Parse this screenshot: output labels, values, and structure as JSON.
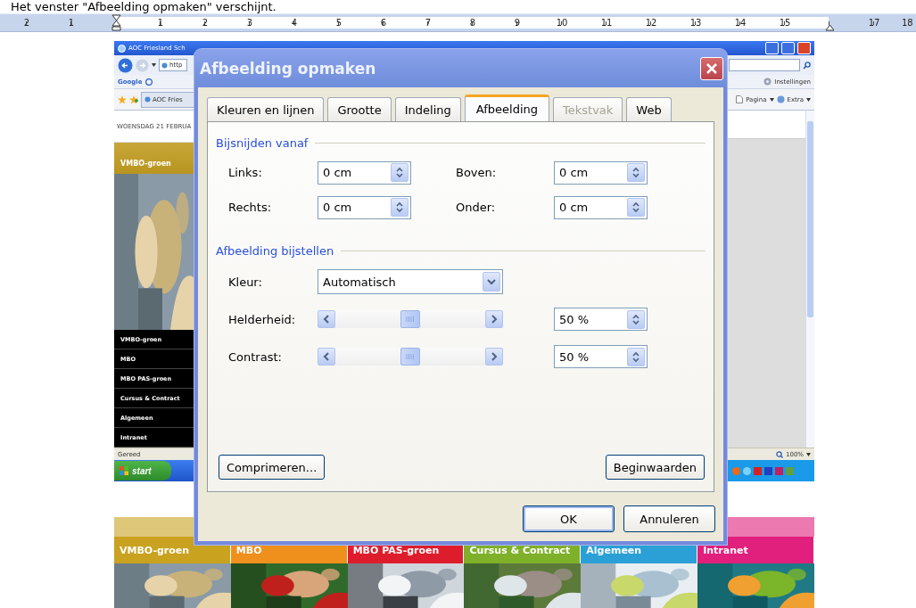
{
  "caption": "Het venster \"Afbeelding opmaken\" verschijnt.",
  "ruler": [
    {
      "kind": "number",
      "label": "2"
    },
    {
      "kind": "number",
      "label": "1"
    },
    {
      "kind": "indent"
    },
    {
      "kind": "number",
      "label": "1"
    },
    {
      "kind": "number",
      "label": "2"
    },
    {
      "kind": "number",
      "label": "3"
    },
    {
      "kind": "number",
      "label": "4"
    },
    {
      "kind": "number",
      "label": "5"
    },
    {
      "kind": "number",
      "label": "6"
    },
    {
      "kind": "number",
      "label": "7"
    },
    {
      "kind": "number",
      "label": "8"
    },
    {
      "kind": "number",
      "label": "9"
    },
    {
      "kind": "number",
      "label": "10"
    },
    {
      "kind": "number",
      "label": "11"
    },
    {
      "kind": "number",
      "label": "12"
    },
    {
      "kind": "number",
      "label": "13"
    },
    {
      "kind": "number",
      "label": "14"
    },
    {
      "kind": "number",
      "label": "15"
    },
    {
      "kind": "margin"
    },
    {
      "kind": "number",
      "label": "17"
    },
    {
      "kind": "number",
      "label": "18"
    }
  ],
  "browser": {
    "title": "AOC Friesland Sch",
    "address": "http",
    "search_brand": "Google",
    "settings": "Instellingen",
    "tab": "AOC Fries",
    "page_menu": "Pagina",
    "extra_menu": "Extra",
    "date": "WOENSDAG 21 FEBRUA",
    "section_title": "VMBO-groen",
    "menu": [
      "VMBO-groen",
      "MBO",
      "MBO PAS-groen",
      "Cursus & Contract",
      "Algemeen",
      "Intranet"
    ],
    "status": "Gereed",
    "zoom": "100%",
    "start": "start"
  },
  "dialog": {
    "title": "Afbeelding opmaken",
    "tabs": [
      {
        "label": "Kleuren en lijnen",
        "selected": false,
        "disabled": false
      },
      {
        "label": "Grootte",
        "selected": false,
        "disabled": false
      },
      {
        "label": "Indeling",
        "selected": false,
        "disabled": false
      },
      {
        "label": "Afbeelding",
        "selected": true,
        "disabled": false
      },
      {
        "label": "Tekstvak",
        "selected": false,
        "disabled": true
      },
      {
        "label": "Web",
        "selected": false,
        "disabled": false
      }
    ],
    "groups": [
      {
        "title": "Bijsnijden vanaf",
        "rows": [
          {
            "kind": "spinners",
            "fields": [
              {
                "label": "Links:",
                "value": "0 cm"
              },
              {
                "label": "Boven:",
                "value": "0 cm"
              }
            ]
          },
          {
            "kind": "spinners",
            "fields": [
              {
                "label": "Rechts:",
                "value": "0 cm"
              },
              {
                "label": "Onder:",
                "value": "0 cm"
              }
            ]
          }
        ]
      },
      {
        "title": "Afbeelding bijstellen",
        "rows": [
          {
            "kind": "dropdown",
            "label": "Kleur:",
            "value": "Automatisch"
          },
          {
            "kind": "slider",
            "label": "Helderheid:",
            "level": 0.5,
            "value": "50 %"
          },
          {
            "kind": "slider",
            "label": "Contrast:",
            "level": 0.5,
            "value": "50 %"
          }
        ]
      }
    ],
    "panel_buttons": [
      "Comprimeren...",
      "Beginwaarden"
    ],
    "buttons": [
      {
        "label": "OK",
        "default": true
      },
      {
        "label": "Annuleren",
        "default": false
      }
    ]
  },
  "banner": [
    {
      "label": "VMBO-groen",
      "color": "#c9a21f"
    },
    {
      "label": "MBO",
      "color": "#ef8f1c"
    },
    {
      "label": "MBO PAS-groen",
      "color": "#de1d2c"
    },
    {
      "label": "Cursus & Contract",
      "color": "#7fb02a"
    },
    {
      "label": "Algemeen",
      "color": "#2ba0d6"
    },
    {
      "label": "Intranet",
      "color": "#e0207c"
    }
  ]
}
